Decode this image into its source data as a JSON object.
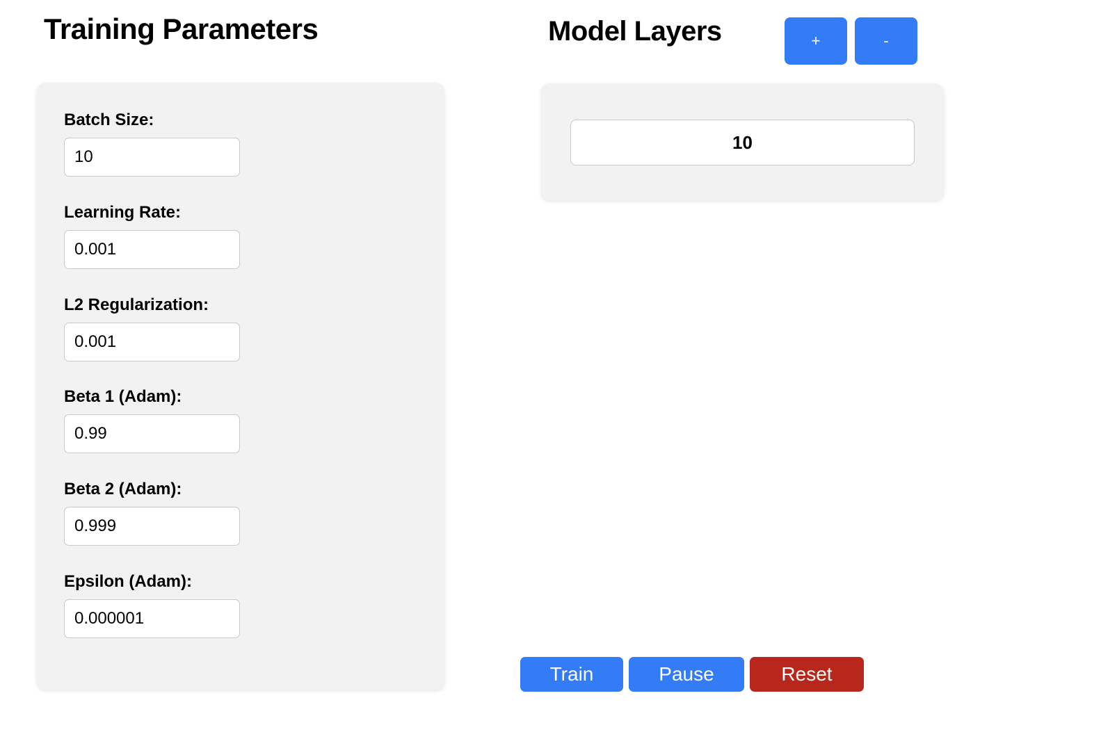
{
  "training": {
    "title": "Training Parameters",
    "fields": [
      {
        "label": "Batch Size:",
        "value": "10"
      },
      {
        "label": "Learning Rate:",
        "value": "0.001"
      },
      {
        "label": "L2 Regularization:",
        "value": "0.001"
      },
      {
        "label": "Beta 1 (Adam):",
        "value": "0.99"
      },
      {
        "label": "Beta 2 (Adam):",
        "value": "0.999"
      },
      {
        "label": "Epsilon (Adam):",
        "value": "0.000001"
      }
    ]
  },
  "layers": {
    "title": "Model Layers",
    "add_label": "+",
    "remove_label": "-",
    "items": [
      {
        "value": "10"
      }
    ]
  },
  "actions": {
    "train_label": "Train",
    "pause_label": "Pause",
    "reset_label": "Reset"
  },
  "colors": {
    "primary": "#337cf5",
    "danger": "#b8271b",
    "panel": "#f2f2f2",
    "input_border": "#c9c9c9",
    "text": "#000000",
    "page_background": "#ffffff"
  }
}
